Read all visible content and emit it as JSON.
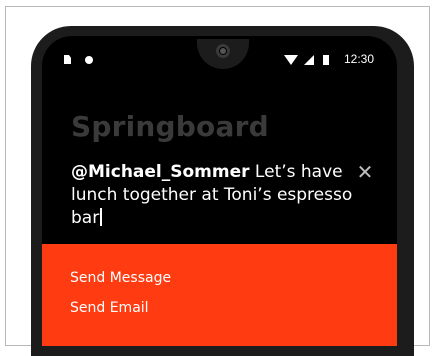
{
  "status_bar": {
    "time": "12:30",
    "icons": [
      "sim-icon",
      "notification-dot-icon",
      "wifi-icon",
      "signal-icon",
      "battery-icon"
    ]
  },
  "app": {
    "title": "Springboard"
  },
  "compose": {
    "mention": "@Michael_Sommer",
    "message": " Let’s have lunch together at Toni’s espresso bar",
    "close_icon": "✕"
  },
  "actions": [
    {
      "label": "Send Message"
    },
    {
      "label": "Send Email"
    }
  ],
  "colors": {
    "action_panel": "#ff3b12",
    "screen_bg": "#000000",
    "title": "#3a3a3a"
  }
}
